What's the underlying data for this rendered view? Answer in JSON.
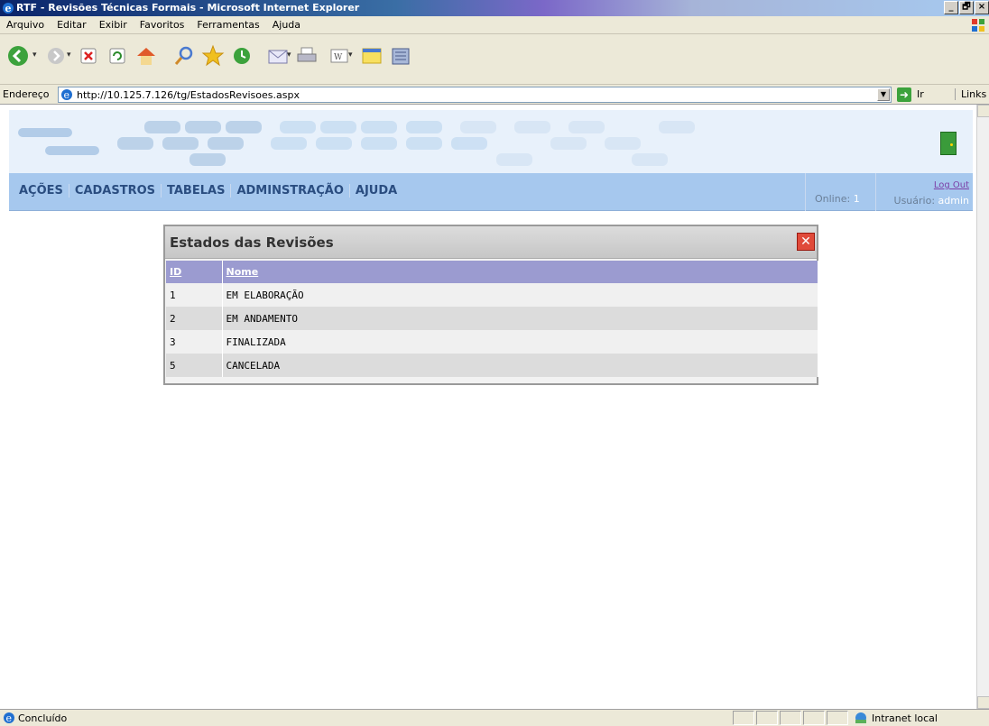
{
  "window": {
    "title": "RTF - Revisões Técnicas Formais - Microsoft Internet Explorer",
    "buttons": [
      "_",
      "🗗",
      "×"
    ]
  },
  "menu": [
    "Arquivo",
    "Editar",
    "Exibir",
    "Favoritos",
    "Ferramentas",
    "Ajuda"
  ],
  "address": {
    "label": "Endereço",
    "url": "http://10.125.7.126/tg/EstadosRevisoes.aspx",
    "go_label": "Ir",
    "links_label": "Links"
  },
  "nav": {
    "items": [
      "AÇÕES",
      "CADASTROS",
      "TABELAS",
      "ADMINSTRAÇÃO",
      "AJUDA"
    ],
    "online_label": "Online:",
    "online_value": "1",
    "logout_label": "Log Out",
    "user_label": "Usuário:",
    "user_value": "admin"
  },
  "panel": {
    "title": "Estados das Revisões",
    "columns": [
      "ID",
      "Nome"
    ],
    "rows": [
      {
        "id": "1",
        "nome": "EM ELABORAÇÃO"
      },
      {
        "id": "2",
        "nome": "EM ANDAMENTO"
      },
      {
        "id": "3",
        "nome": "FINALIZADA"
      },
      {
        "id": "5",
        "nome": "CANCELADA"
      }
    ]
  },
  "status": {
    "text": "Concluído",
    "zone": "Intranet local"
  },
  "colors": {
    "nav_bg": "#a6c8ee",
    "nav_text": "#2a4d80",
    "table_header": "#9b9bd0",
    "close_button": "#e04a3a"
  }
}
